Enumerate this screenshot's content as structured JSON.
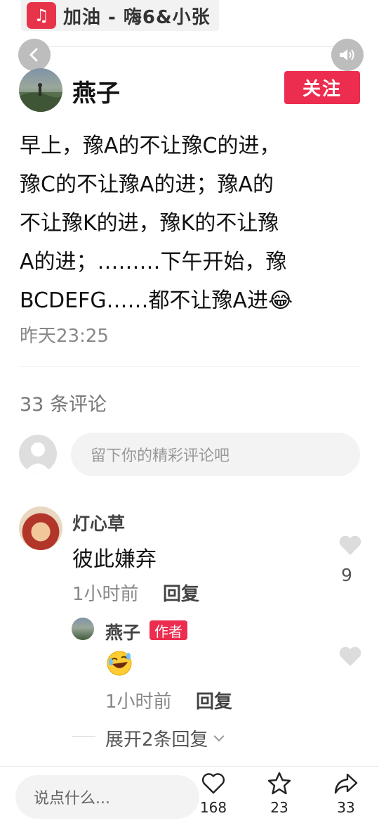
{
  "music_banner": {
    "title": "加油 - 嗨6&小张",
    "icon": "music-note-icon"
  },
  "header": {
    "back_icon": "chevron-left-icon",
    "sound_icon": "speaker-icon"
  },
  "author": {
    "name": "燕子",
    "follow_label": "关注"
  },
  "post": {
    "lines": [
      "早上，豫A的不让豫C的进，",
      "豫C的不让豫A的进；豫A的",
      "不让豫K的进，豫K的不让豫",
      "A的进；………下午开始，豫",
      "BCDEFG……都不让豫A进😂"
    ],
    "time": "昨天23:25"
  },
  "comments_section": {
    "count_label": "33 条评论",
    "input_placeholder": "留下你的精彩评论吧"
  },
  "comment": {
    "user": "灯心草",
    "text": "彼此嫌弃",
    "time": "1小时前",
    "reply_label": "回复",
    "like_count": "9"
  },
  "reply": {
    "user": "燕子",
    "badge": "作者",
    "emoji": "🤣",
    "time": "1小时前",
    "reply_label": "回复"
  },
  "expand": {
    "label": "展开2条回复"
  },
  "bottom_bar": {
    "input_placeholder": "说点什么...",
    "like_count": "168",
    "fav_count": "23",
    "share_count": "33"
  },
  "colors": {
    "accent": "#ec2d4f",
    "music_icon_bg": "#e8344a"
  }
}
